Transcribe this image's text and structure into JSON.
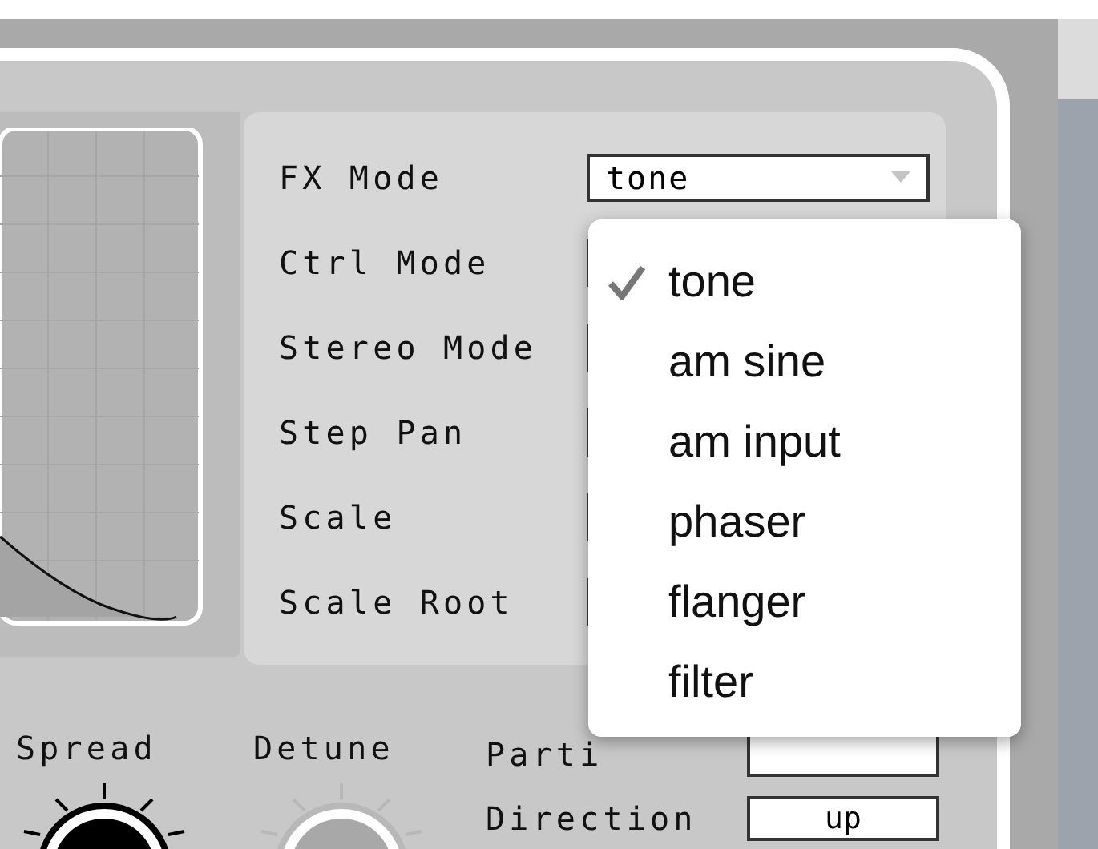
{
  "fx_mode": {
    "label": "FX Mode",
    "value": "tone"
  },
  "settings": [
    {
      "label": "Ctrl Mode"
    },
    {
      "label": "Stereo Mode"
    },
    {
      "label": "Step Pan"
    },
    {
      "label": "Scale"
    },
    {
      "label": "Scale Root"
    }
  ],
  "menu": {
    "items": [
      {
        "label": "tone",
        "selected": true
      },
      {
        "label": "am sine",
        "selected": false
      },
      {
        "label": "am input",
        "selected": false
      },
      {
        "label": "phaser",
        "selected": false
      },
      {
        "label": "flanger",
        "selected": false
      },
      {
        "label": "filter",
        "selected": false
      }
    ]
  },
  "knobs": [
    {
      "label": "Spread",
      "kind": "dark"
    },
    {
      "label": "Detune",
      "kind": "light"
    }
  ],
  "fields": [
    {
      "label": "Parti"
    },
    {
      "label": "Direction",
      "value": "up"
    }
  ]
}
